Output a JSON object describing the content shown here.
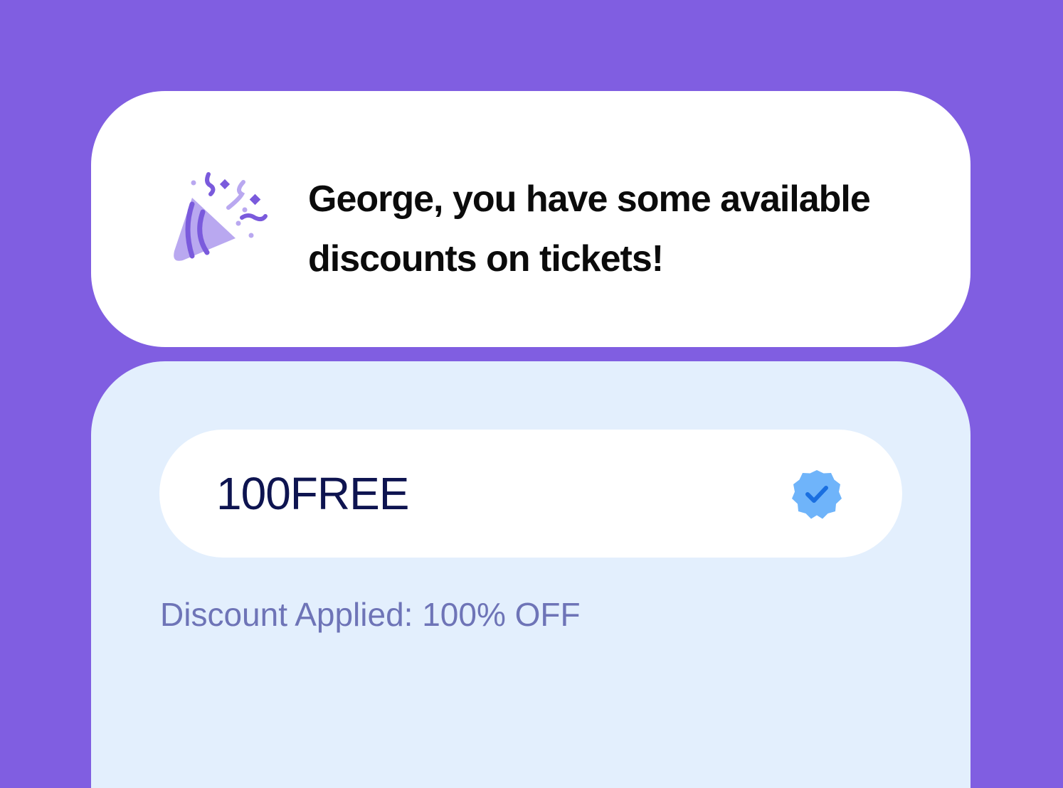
{
  "banner": {
    "icon": "party-popper-icon",
    "message_line1": "George, you have some available",
    "message_line2": "discounts on tickets!"
  },
  "discount": {
    "code_value": "100FREE",
    "status_icon": "verified-check-icon",
    "status_text": "Discount Applied: 100% OFF"
  },
  "colors": {
    "background": "#805EE1",
    "card": "#FFFFFF",
    "panel": "#E3EFFD",
    "icon_light": "#B9A8F0",
    "icon_dark": "#7A5ADC",
    "verified_badge": "#6FB4FA",
    "verified_check": "#1A6FE0",
    "code_text": "#0E1450",
    "status_text": "#6E74B7"
  }
}
